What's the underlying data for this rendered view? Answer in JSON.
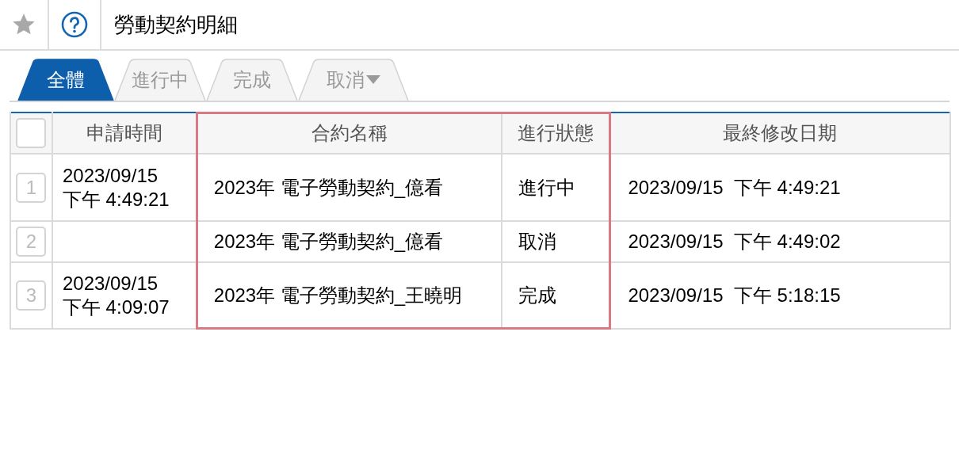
{
  "header": {
    "title": "勞動契約明細"
  },
  "tabs": [
    {
      "label": "全體",
      "selected": true
    },
    {
      "label": "進行中",
      "selected": false
    },
    {
      "label": "完成",
      "selected": false
    },
    {
      "label": "取消",
      "selected": false,
      "dropdown": true
    }
  ],
  "table": {
    "select_all": {
      "checked": false
    },
    "columns": [
      "申請時間",
      "合約名稱",
      "進行狀態",
      "最終修改日期"
    ],
    "rows": [
      {
        "number": "1",
        "applied_date": "2023/09/15",
        "applied_time": "下午 4:49:21",
        "contract": "2023年 電子勞動契約_億看",
        "status": "進行中",
        "modified": "2023/09/15  下午 4:49:21"
      },
      {
        "number": "2",
        "contract": "2023年 電子勞動契約_億看",
        "status": "取消",
        "modified": "2023/09/15  下午 4:49:02"
      },
      {
        "number": "3",
        "applied_date": "2023/09/15",
        "applied_time": "下午 4:09:07",
        "contract": "2023年 電子勞動契約_王曉明",
        "status": "完成",
        "modified": "2023/09/15  下午 5:18:15"
      }
    ]
  }
}
